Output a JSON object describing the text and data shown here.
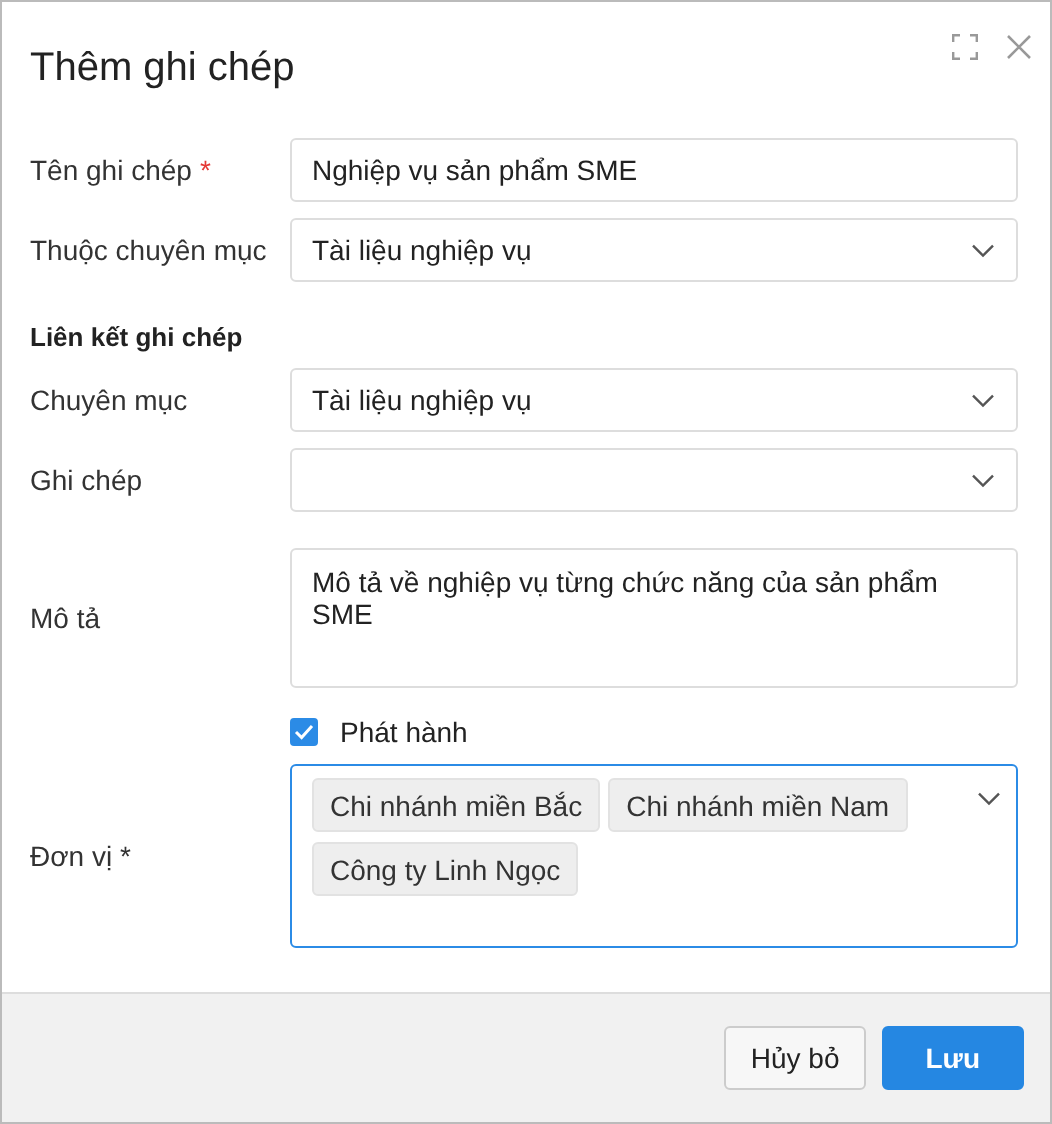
{
  "dialog": {
    "title": "Thêm ghi chép"
  },
  "fields_top": [
    {
      "kind": "text",
      "label": "Tên ghi chép",
      "required_mark": "*",
      "value": "Nghiệp vụ sản phẩm SME"
    },
    {
      "kind": "select",
      "label": "Thuộc chuyên mục",
      "value": "Tài liệu nghiệp vụ"
    }
  ],
  "section": {
    "title": "Liên kết ghi chép"
  },
  "fields": [
    {
      "kind": "select",
      "label": "Chuyên mục",
      "value": "Tài liệu nghiệp vụ"
    },
    {
      "kind": "select",
      "label": "Ghi chép"
    },
    {
      "kind": "textarea",
      "label": "Mô tả",
      "value": "Mô tả về nghiệp vụ từng chức năng của sản phẩm SME"
    },
    {
      "kind": "checkbox",
      "label": "Phát hành",
      "checked": true
    },
    {
      "kind": "tags",
      "label": "Đơn vị *",
      "focused": true,
      "tags": [
        "Chi nhánh miền Bắc",
        "Chi nhánh miền Nam",
        "Công ty Linh Ngọc"
      ]
    }
  ],
  "buttons": [
    {
      "kind": "secondary",
      "label": "Hủy bỏ"
    },
    {
      "kind": "primary",
      "label": "Lưu"
    }
  ]
}
